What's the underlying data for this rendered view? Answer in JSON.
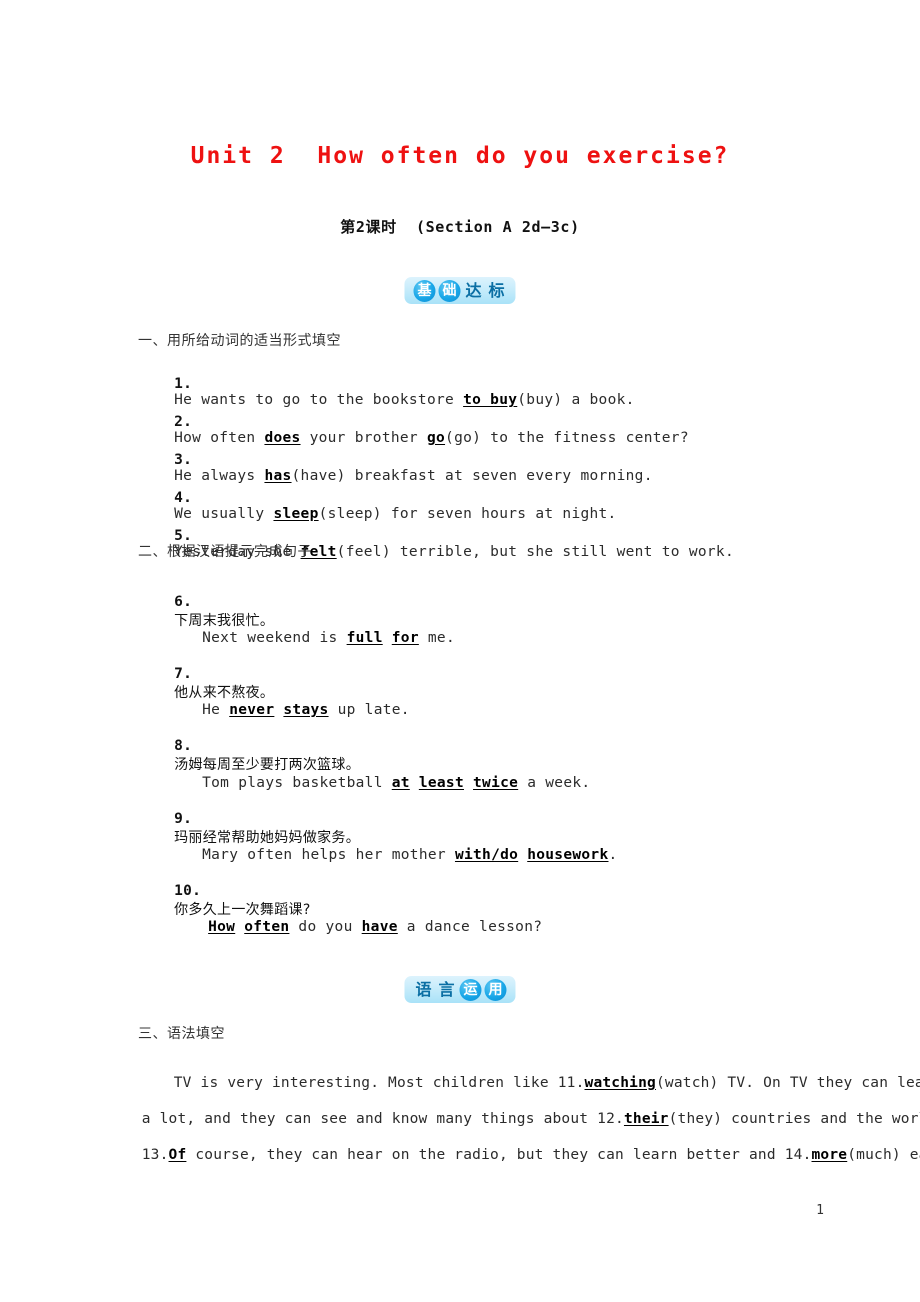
{
  "document": {
    "title": "Unit 2  How often do you exercise?",
    "subtitle": "第2课时  (Section A 2d—3c)",
    "page_number": "1",
    "title_color": "#ee1111",
    "badge_bg_color": "#c7ecfb",
    "badge_circle_color": "#18a6e8"
  },
  "badges": {
    "basics": {
      "chars": [
        "基",
        "础",
        "达",
        "标"
      ],
      "circled": [
        true,
        true,
        false,
        false
      ],
      "label": "基础达标"
    },
    "language": {
      "chars": [
        "语",
        "言",
        "运",
        "用"
      ],
      "circled": [
        false,
        false,
        true,
        true
      ],
      "label": "语言运用"
    }
  },
  "section_one": {
    "heading": "一、用所给动词的适当形式填空",
    "items": [
      {
        "num": "1.",
        "pre": "He wants to go to the bookstore ",
        "answer": "to buy",
        "post": "(buy) a book."
      },
      {
        "num": "2.",
        "pre": "How often ",
        "answer": "does",
        "mid": " your brother ",
        "answer2": "go",
        "post": "(go) to the fitness center?"
      },
      {
        "num": "3.",
        "pre": "He always ",
        "answer": "has",
        "post": "(have) breakfast at seven every morning."
      },
      {
        "num": "4.",
        "pre": "We usually ",
        "answer": "sleep",
        "post": "(sleep) for seven hours at night."
      },
      {
        "num": "5.",
        "pre": "Yesterday she ",
        "answer": "felt",
        "post": "(feel) terrible, but she still went to work."
      }
    ]
  },
  "section_two": {
    "heading": "二、根据汉语提示完成句子",
    "items": [
      {
        "num": "6.",
        "chinese": "下周末我很忙。",
        "pre": "Next weekend is ",
        "answer": "full",
        "mid": " ",
        "answer2": "for",
        "post": " me."
      },
      {
        "num": "7.",
        "chinese": "他从来不熬夜。",
        "pre": "He ",
        "answer": "never",
        "mid": " ",
        "answer2": "stays",
        "post": " up late."
      },
      {
        "num": "8.",
        "chinese": "汤姆每周至少要打两次篮球。",
        "pre": "Tom plays basketball ",
        "answer": "at",
        "mid": " ",
        "answer2": "least",
        "mid2": " ",
        "answer3": "twice",
        "post": " a week."
      },
      {
        "num": "9.",
        "chinese": "玛丽经常帮助她妈妈做家务。",
        "pre": "Mary often helps her mother ",
        "answer": "with/do",
        "mid": " ",
        "answer2": "housework",
        "post": "."
      },
      {
        "num": "10.",
        "chinese": "你多久上一次舞蹈课?",
        "pre": "",
        "answer": "How",
        "mid": " ",
        "answer2": "often",
        "mid2": " do you ",
        "answer3": "have",
        "post": " a dance lesson?"
      }
    ]
  },
  "section_three": {
    "heading": "三、语法填空",
    "lines": [
      {
        "pre": "TV is very interesting. Most children like ",
        "num": "11.",
        "answer": "watching",
        "post": "(watch) TV. On TV they can learn"
      },
      {
        "pre": "a lot, and they can see and know many things about ",
        "num": "12.",
        "answer": "their",
        "post": "(they) countries and the world."
      },
      {
        "pre": "",
        "num": "13.",
        "answer": "Of",
        "mid": " course, they can hear on the radio, but they can learn better and ",
        "num2": "14.",
        "answer2": "more",
        "post": "(much) easily"
      }
    ]
  }
}
